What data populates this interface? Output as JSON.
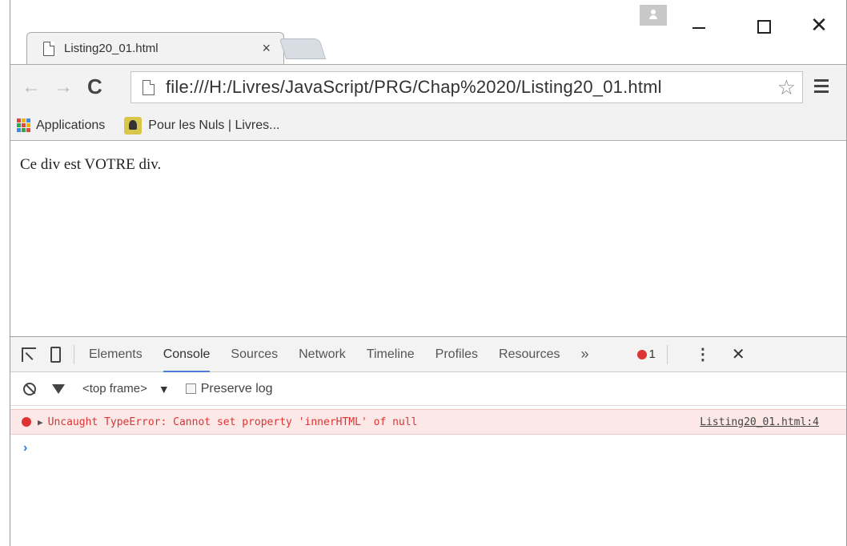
{
  "tab": {
    "title": "Listing20_01.html",
    "close": "×"
  },
  "window_controls": {
    "close": "✕"
  },
  "toolbar": {
    "back": "←",
    "forward": "→",
    "reload": "C",
    "url": "file:///H:/Livres/JavaScript/PRG/Chap%2020/Listing20_01.html",
    "star": "☆"
  },
  "bookmarks": {
    "apps_label": "Applications",
    "item_label": "Pour les Nuls | Livres..."
  },
  "page": {
    "text": "Ce div est VOTRE div."
  },
  "devtools": {
    "tabs": [
      "Elements",
      "Console",
      "Sources",
      "Network",
      "Timeline",
      "Profiles",
      "Resources"
    ],
    "active_tab": "Console",
    "more": "»",
    "error_count": "1",
    "kebab": "⋮",
    "close": "✕",
    "frame": "<top frame>",
    "frame_arrow": "▼",
    "preserve_log": "Preserve log",
    "error_message": "Uncaught TypeError: Cannot set property 'innerHTML' of null",
    "error_source": "Listing20_01.html:4",
    "prompt": "›"
  },
  "colors": {
    "error": "#dd3333",
    "error_bg": "#fde8e8",
    "active_tab_underline": "#4a7fd4"
  }
}
